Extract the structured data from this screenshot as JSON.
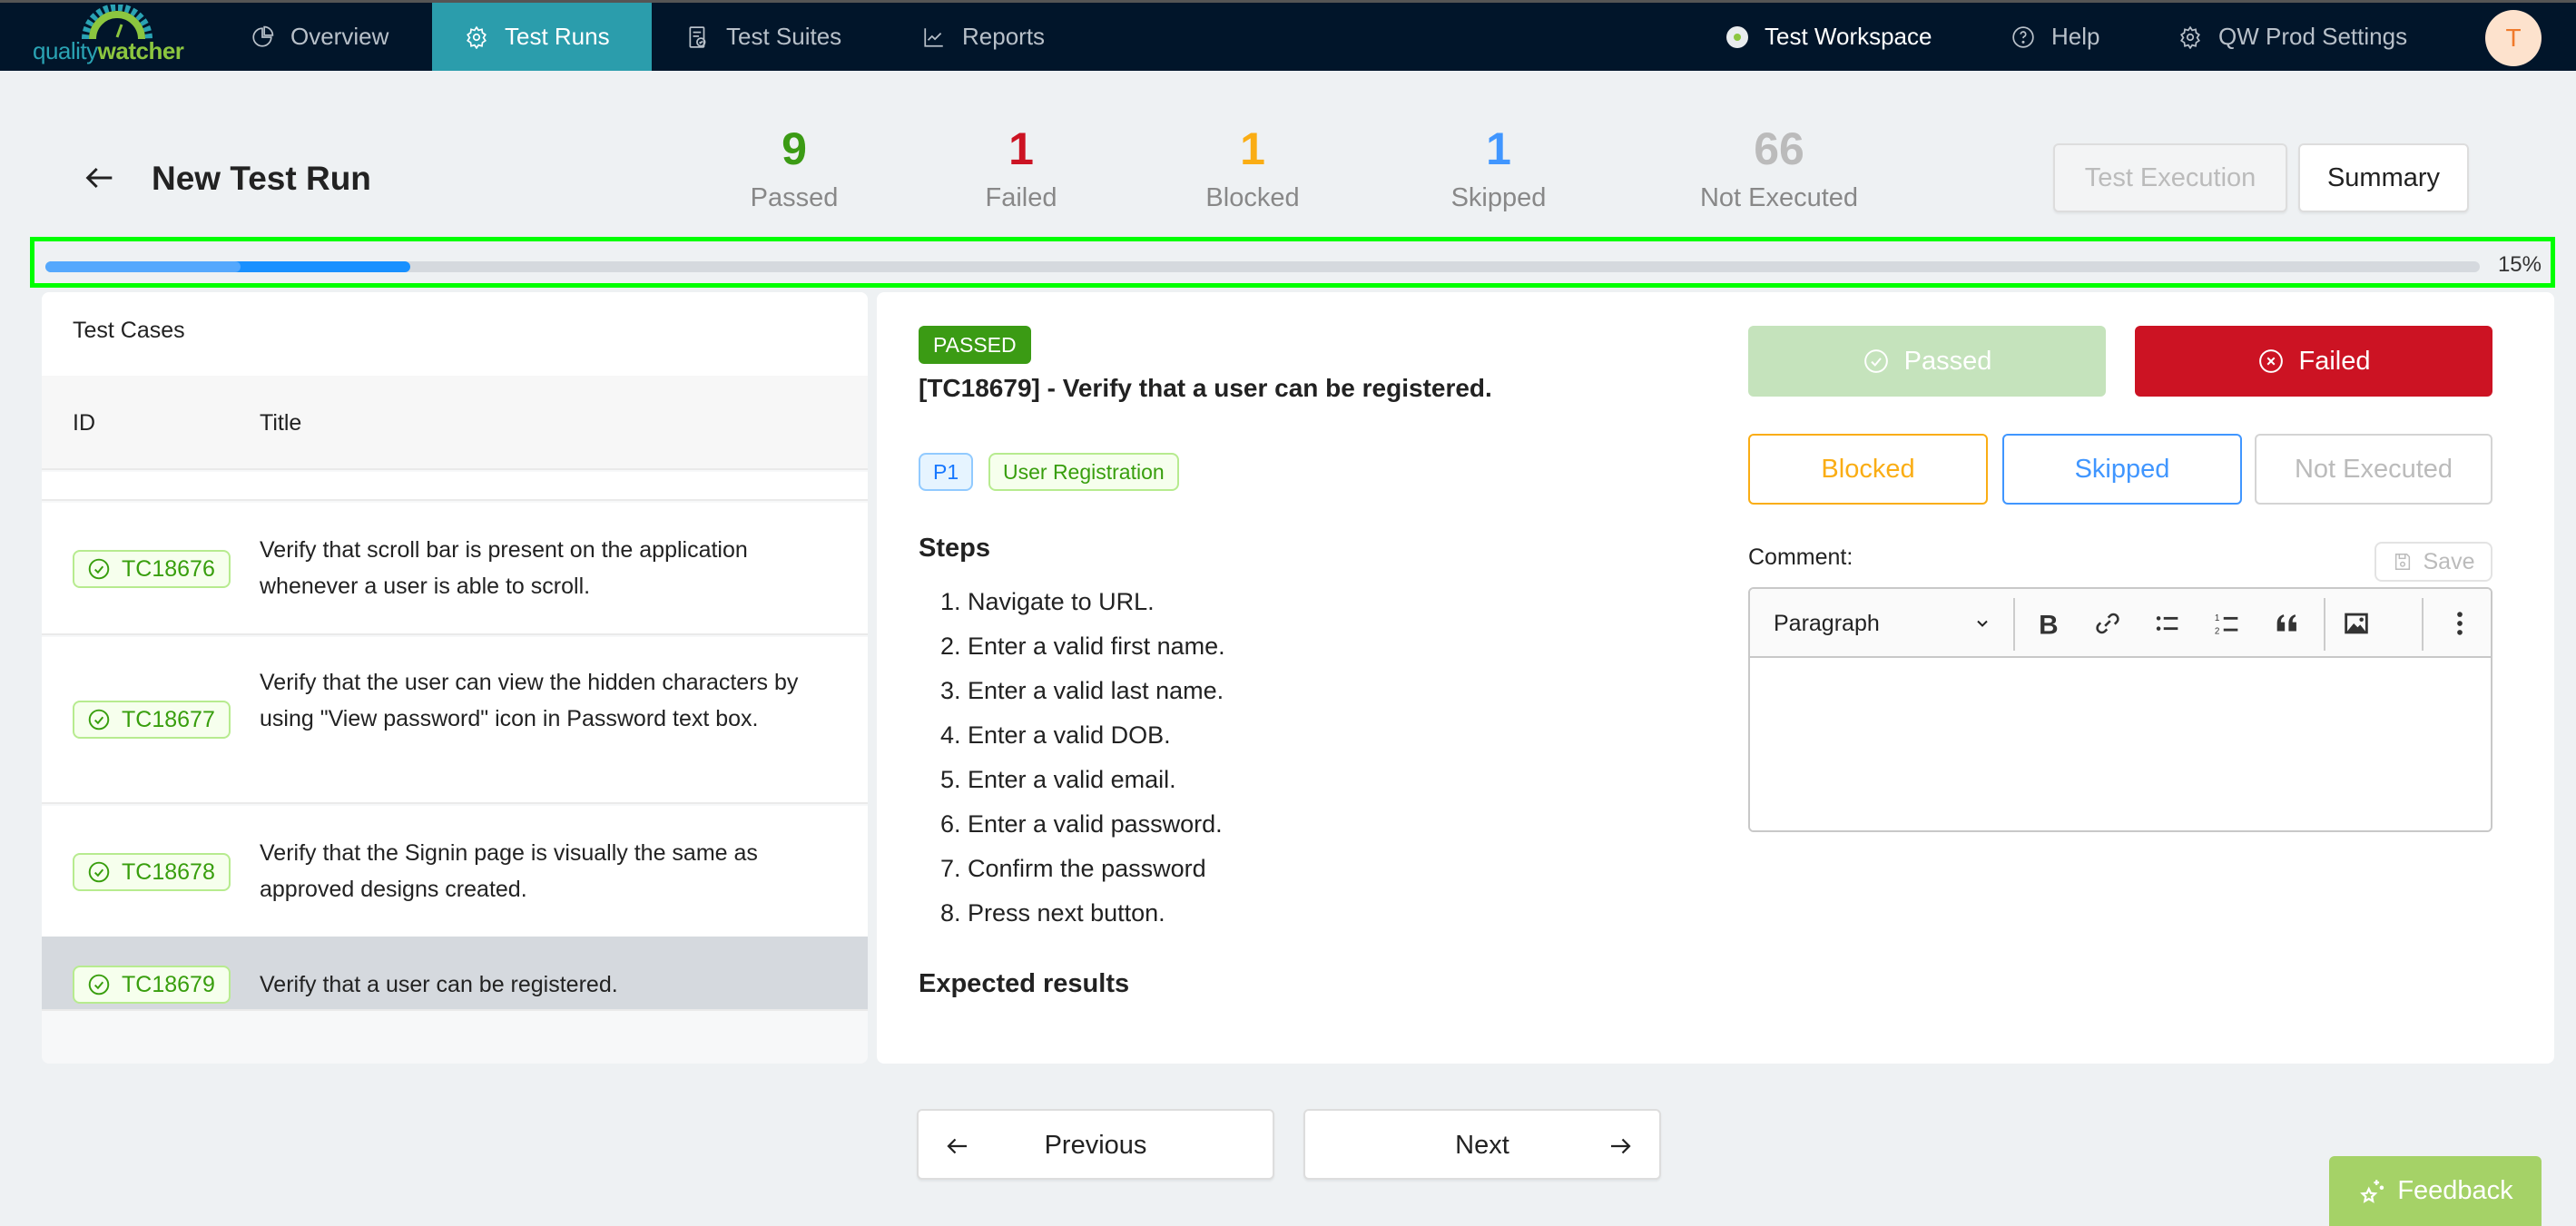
{
  "app": {
    "brand_part1": "quality",
    "brand_part2": "watcher"
  },
  "topnav": {
    "items": [
      {
        "label": "Overview",
        "icon": "pie-chart-icon",
        "active": false
      },
      {
        "label": "Test Runs",
        "icon": "gear-icon",
        "active": true
      },
      {
        "label": "Test Suites",
        "icon": "clipboard-check-icon",
        "active": false
      },
      {
        "label": "Reports",
        "icon": "line-chart-icon",
        "active": false
      }
    ],
    "workspace": "Test Workspace",
    "help": "Help",
    "settings": "QW Prod Settings",
    "avatar_initial": "T"
  },
  "header": {
    "title": "New Test Run",
    "stats": [
      {
        "value": "9",
        "label": "Passed",
        "color": "#3b9b14"
      },
      {
        "value": "1",
        "label": "Failed",
        "color": "#cc1323"
      },
      {
        "value": "1",
        "label": "Blocked",
        "color": "#faad14"
      },
      {
        "value": "1",
        "label": "Skipped",
        "color": "#4096ff"
      },
      {
        "value": "66",
        "label": "Not Executed",
        "color": "#bbbbbb"
      }
    ],
    "test_execution_label": "Test Execution",
    "summary_label": "Summary"
  },
  "progress": {
    "percent_label": "15%",
    "completed_fraction": 0.15,
    "passed_fraction": 0.08
  },
  "test_cases": {
    "title": "Test Cases",
    "col_id": "ID",
    "col_title": "Title",
    "rows": [
      {
        "id": "TC18676",
        "status": "passed",
        "title": "Verify that scroll bar is present on the application whenever a user is able to scroll.",
        "selected": false
      },
      {
        "id": "TC18677",
        "status": "passed",
        "title": "Verify that the user can view the hidden characters by using \"View password\" icon in Password text box.",
        "selected": false
      },
      {
        "id": "TC18678",
        "status": "passed",
        "title": "Verify that the Signin page is visually the same as approved designs created.",
        "selected": false
      },
      {
        "id": "TC18679",
        "status": "passed",
        "title": "Verify that a user can be registered.",
        "selected": true
      }
    ]
  },
  "detail": {
    "status_tag": "PASSED",
    "heading": "[TC18679] - Verify that a user can be registered.",
    "priority": "P1",
    "category": "User Registration",
    "steps_heading": "Steps",
    "steps": [
      "1. Navigate to URL.",
      "2. Enter a valid first name.",
      "3. Enter a valid last name.",
      "4. Enter a valid DOB.",
      "5. Enter a valid email.",
      "6. Enter a valid password.",
      "7. Confirm the password",
      "8. Press next button."
    ],
    "expected_heading": "Expected results",
    "buttons": {
      "passed": "Passed",
      "failed": "Failed",
      "blocked": "Blocked",
      "skipped": "Skipped",
      "not_executed": "Not Executed"
    },
    "comment_label": "Comment:",
    "save_label": "Save",
    "editor": {
      "paragraph_style": "Paragraph",
      "value": ""
    }
  },
  "pager": {
    "previous": "Previous",
    "next": "Next"
  },
  "feedback_label": "Feedback"
}
